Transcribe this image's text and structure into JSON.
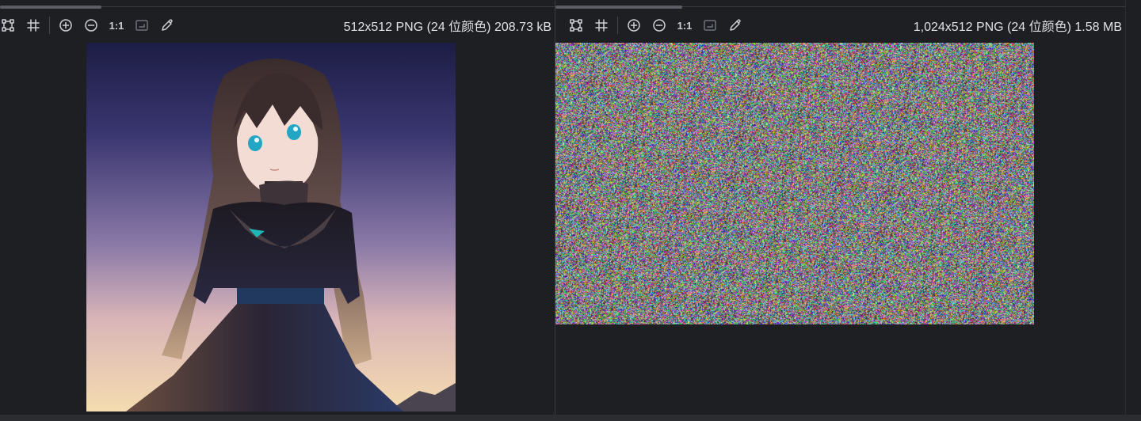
{
  "left_viewer": {
    "toolbar": {
      "zoom_actual_label": "1:1",
      "info": "512x512 PNG (24 位颜色) 208.73 kB"
    },
    "image": {
      "kind": "anime illustration"
    }
  },
  "right_viewer": {
    "toolbar": {
      "zoom_actual_label": "1:1",
      "info": "1,024x512 PNG (24 位颜色) 1.58 MB"
    },
    "image": {
      "kind": "random color noise"
    }
  },
  "icons": [
    "fit-grid-icon",
    "crop-grid-icon",
    "zoom-in-icon",
    "zoom-out-icon",
    "fit-window-icon",
    "color-picker-icon"
  ],
  "colors": {
    "background": "#1e1f22",
    "icon": "#ced0d6",
    "text": "#dfe1e5",
    "divider": "#393b40"
  }
}
